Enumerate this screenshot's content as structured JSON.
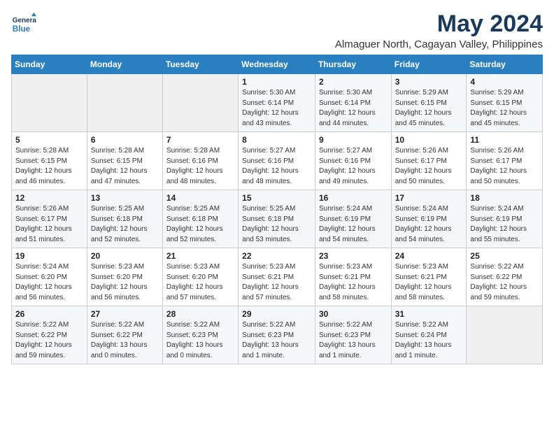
{
  "logo": {
    "general": "General",
    "blue": "Blue"
  },
  "title": "May 2024",
  "subtitle": "Almaguer North, Cagayan Valley, Philippines",
  "weekdays": [
    "Sunday",
    "Monday",
    "Tuesday",
    "Wednesday",
    "Thursday",
    "Friday",
    "Saturday"
  ],
  "weeks": [
    [
      {
        "day": "",
        "info": ""
      },
      {
        "day": "",
        "info": ""
      },
      {
        "day": "",
        "info": ""
      },
      {
        "day": "1",
        "info": "Sunrise: 5:30 AM\nSunset: 6:14 PM\nDaylight: 12 hours\nand 43 minutes."
      },
      {
        "day": "2",
        "info": "Sunrise: 5:30 AM\nSunset: 6:14 PM\nDaylight: 12 hours\nand 44 minutes."
      },
      {
        "day": "3",
        "info": "Sunrise: 5:29 AM\nSunset: 6:15 PM\nDaylight: 12 hours\nand 45 minutes."
      },
      {
        "day": "4",
        "info": "Sunrise: 5:29 AM\nSunset: 6:15 PM\nDaylight: 12 hours\nand 45 minutes."
      }
    ],
    [
      {
        "day": "5",
        "info": "Sunrise: 5:28 AM\nSunset: 6:15 PM\nDaylight: 12 hours\nand 46 minutes."
      },
      {
        "day": "6",
        "info": "Sunrise: 5:28 AM\nSunset: 6:15 PM\nDaylight: 12 hours\nand 47 minutes."
      },
      {
        "day": "7",
        "info": "Sunrise: 5:28 AM\nSunset: 6:16 PM\nDaylight: 12 hours\nand 48 minutes."
      },
      {
        "day": "8",
        "info": "Sunrise: 5:27 AM\nSunset: 6:16 PM\nDaylight: 12 hours\nand 48 minutes."
      },
      {
        "day": "9",
        "info": "Sunrise: 5:27 AM\nSunset: 6:16 PM\nDaylight: 12 hours\nand 49 minutes."
      },
      {
        "day": "10",
        "info": "Sunrise: 5:26 AM\nSunset: 6:17 PM\nDaylight: 12 hours\nand 50 minutes."
      },
      {
        "day": "11",
        "info": "Sunrise: 5:26 AM\nSunset: 6:17 PM\nDaylight: 12 hours\nand 50 minutes."
      }
    ],
    [
      {
        "day": "12",
        "info": "Sunrise: 5:26 AM\nSunset: 6:17 PM\nDaylight: 12 hours\nand 51 minutes."
      },
      {
        "day": "13",
        "info": "Sunrise: 5:25 AM\nSunset: 6:18 PM\nDaylight: 12 hours\nand 52 minutes."
      },
      {
        "day": "14",
        "info": "Sunrise: 5:25 AM\nSunset: 6:18 PM\nDaylight: 12 hours\nand 52 minutes."
      },
      {
        "day": "15",
        "info": "Sunrise: 5:25 AM\nSunset: 6:18 PM\nDaylight: 12 hours\nand 53 minutes."
      },
      {
        "day": "16",
        "info": "Sunrise: 5:24 AM\nSunset: 6:19 PM\nDaylight: 12 hours\nand 54 minutes."
      },
      {
        "day": "17",
        "info": "Sunrise: 5:24 AM\nSunset: 6:19 PM\nDaylight: 12 hours\nand 54 minutes."
      },
      {
        "day": "18",
        "info": "Sunrise: 5:24 AM\nSunset: 6:19 PM\nDaylight: 12 hours\nand 55 minutes."
      }
    ],
    [
      {
        "day": "19",
        "info": "Sunrise: 5:24 AM\nSunset: 6:20 PM\nDaylight: 12 hours\nand 56 minutes."
      },
      {
        "day": "20",
        "info": "Sunrise: 5:23 AM\nSunset: 6:20 PM\nDaylight: 12 hours\nand 56 minutes."
      },
      {
        "day": "21",
        "info": "Sunrise: 5:23 AM\nSunset: 6:20 PM\nDaylight: 12 hours\nand 57 minutes."
      },
      {
        "day": "22",
        "info": "Sunrise: 5:23 AM\nSunset: 6:21 PM\nDaylight: 12 hours\nand 57 minutes."
      },
      {
        "day": "23",
        "info": "Sunrise: 5:23 AM\nSunset: 6:21 PM\nDaylight: 12 hours\nand 58 minutes."
      },
      {
        "day": "24",
        "info": "Sunrise: 5:23 AM\nSunset: 6:21 PM\nDaylight: 12 hours\nand 58 minutes."
      },
      {
        "day": "25",
        "info": "Sunrise: 5:22 AM\nSunset: 6:22 PM\nDaylight: 12 hours\nand 59 minutes."
      }
    ],
    [
      {
        "day": "26",
        "info": "Sunrise: 5:22 AM\nSunset: 6:22 PM\nDaylight: 12 hours\nand 59 minutes."
      },
      {
        "day": "27",
        "info": "Sunrise: 5:22 AM\nSunset: 6:22 PM\nDaylight: 13 hours\nand 0 minutes."
      },
      {
        "day": "28",
        "info": "Sunrise: 5:22 AM\nSunset: 6:23 PM\nDaylight: 13 hours\nand 0 minutes."
      },
      {
        "day": "29",
        "info": "Sunrise: 5:22 AM\nSunset: 6:23 PM\nDaylight: 13 hours\nand 1 minute."
      },
      {
        "day": "30",
        "info": "Sunrise: 5:22 AM\nSunset: 6:23 PM\nDaylight: 13 hours\nand 1 minute."
      },
      {
        "day": "31",
        "info": "Sunrise: 5:22 AM\nSunset: 6:24 PM\nDaylight: 13 hours\nand 1 minute."
      },
      {
        "day": "",
        "info": ""
      }
    ]
  ]
}
